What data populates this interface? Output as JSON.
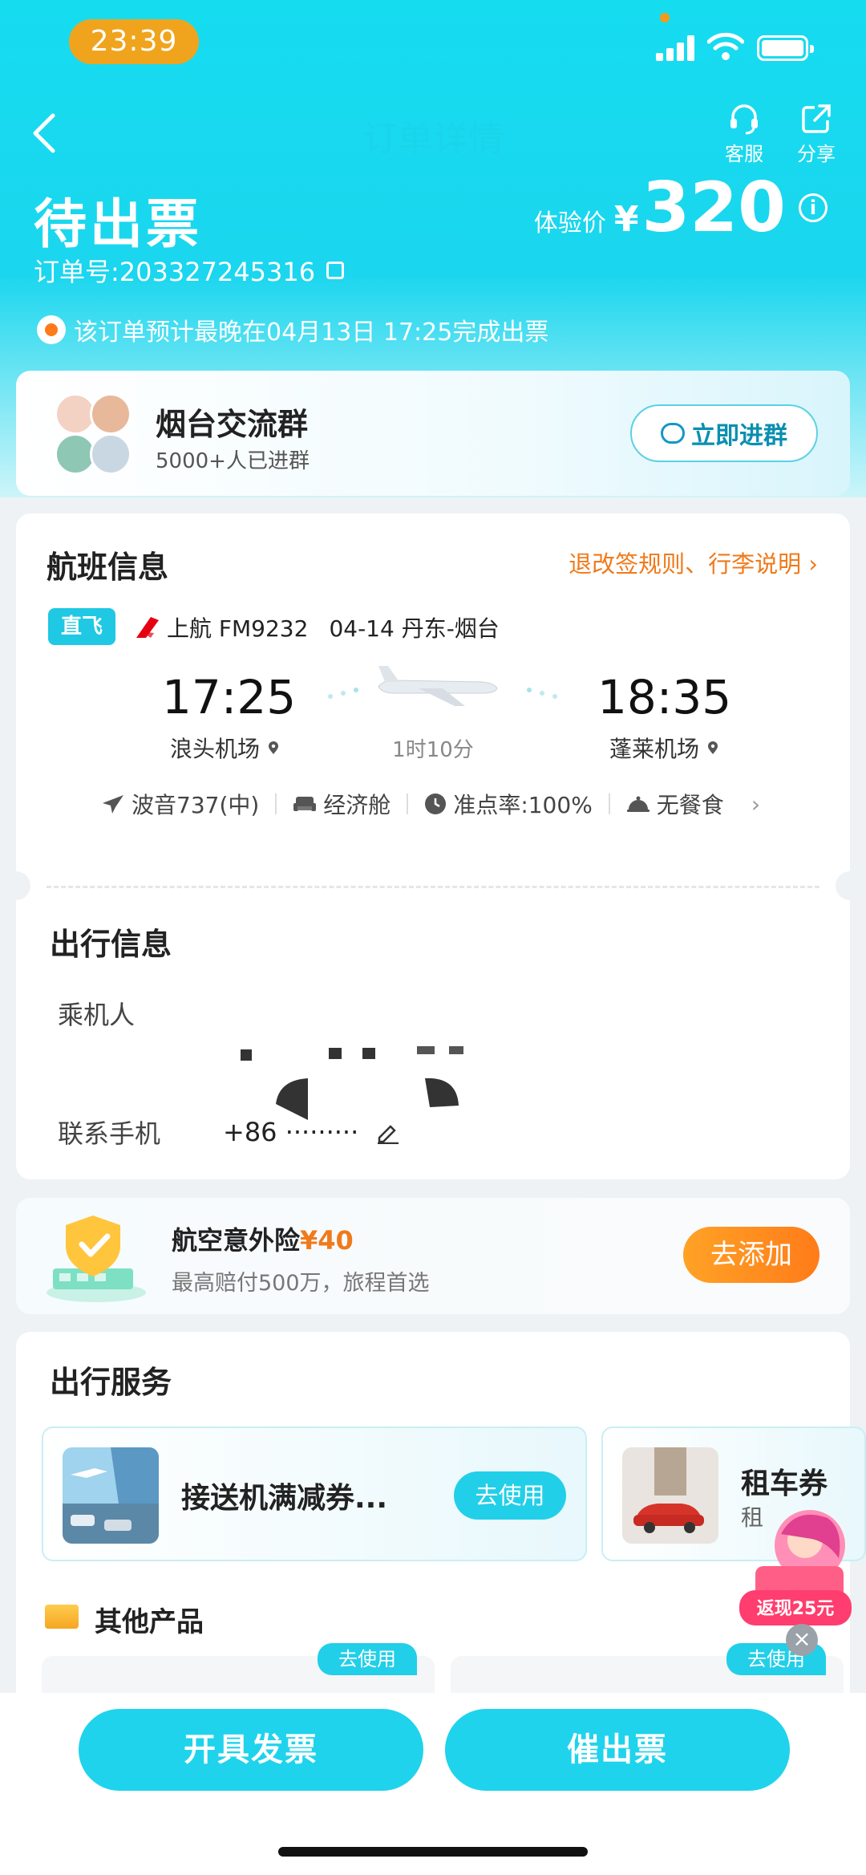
{
  "status_bar": {
    "time": "23:39"
  },
  "nav": {
    "title": "订单详情",
    "service_label": "客服",
    "share_label": "分享"
  },
  "order": {
    "status": "待出票",
    "price_label": "体验价",
    "currency": "¥",
    "price": "320",
    "order_no": "订单号:203327245316",
    "notice": "该订单预计最晚在04月13日 17:25完成出票"
  },
  "group": {
    "name": "烟台交流群",
    "members": "5000+人已进群",
    "join_label": "立即进群"
  },
  "flight": {
    "section_title": "航班信息",
    "rules_link": "退改签规则、行李说明",
    "direct_tag": "直飞",
    "airline": "上航 FM9232",
    "date_route": "04-14 丹东-烟台",
    "dep_time": "17:25",
    "dep_airport": "浪头机场",
    "arr_time": "18:35",
    "arr_airport": "蓬莱机场",
    "duration": "1时10分",
    "aircraft": "波音737(中)",
    "cabin": "经济舱",
    "on_time": "准点率:100%",
    "meal": "无餐食"
  },
  "travel": {
    "section_title": "出行信息",
    "passenger_label": "乘机人",
    "phone_label": "联系手机",
    "phone_value": "+86 ·········"
  },
  "insurance": {
    "title": "航空意外险",
    "amount": "¥40",
    "subtitle": "最高赔付500万，旅程首选",
    "button": "去添加"
  },
  "services": {
    "section_title": "出行服务",
    "items": [
      {
        "name": "接送机满减券...",
        "button": "去使用"
      },
      {
        "name": "租车券",
        "sub": "租"
      }
    ],
    "other_title": "其他产品",
    "product_tags": [
      "去使用",
      "去使用"
    ],
    "promo_text": "返现25元"
  },
  "bottom": {
    "invoice_label": "开具发票",
    "urge_label": "催出票"
  },
  "colors": {
    "accent": "#1fd3ec",
    "orange": "#f07a1b"
  }
}
